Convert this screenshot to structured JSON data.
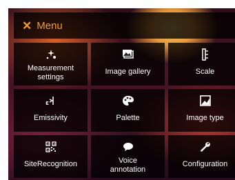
{
  "header": {
    "close_symbol": "✕",
    "title": "Menu"
  },
  "colors": {
    "accent": "#f39c1f",
    "tile_bg": "rgba(0,0,0,0.78)",
    "text": "#ffffff"
  },
  "tiles": [
    {
      "label": "Measurement\nsettings",
      "icon": "measurement-settings-icon"
    },
    {
      "label": "Image gallery",
      "icon": "image-gallery-icon"
    },
    {
      "label": "Scale",
      "icon": "scale-icon"
    },
    {
      "label": "Emissivity",
      "icon": "emissivity-icon"
    },
    {
      "label": "Palette",
      "icon": "palette-icon"
    },
    {
      "label": "Image type",
      "icon": "image-type-icon"
    },
    {
      "label": "SiteRecognition",
      "icon": "qr-code-icon"
    },
    {
      "label": "Voice\nannotation",
      "icon": "speech-bubble-icon"
    },
    {
      "label": "Configuration",
      "icon": "wrench-icon"
    }
  ]
}
